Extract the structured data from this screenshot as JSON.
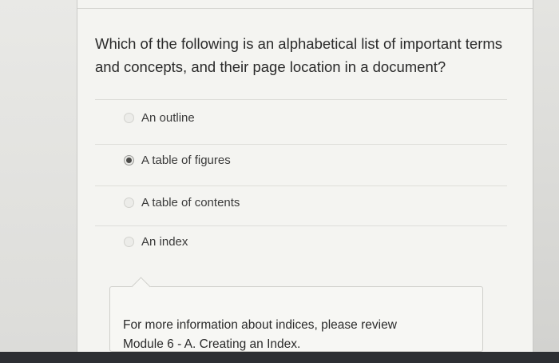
{
  "question": {
    "text_line1": "Which of the following is an alphabetical list of important terms",
    "text_line2": "and concepts, and their page location in a document?"
  },
  "options": [
    {
      "label": "An outline",
      "selected": false
    },
    {
      "label": "A table of figures",
      "selected": true
    },
    {
      "label": "A table of contents",
      "selected": false
    },
    {
      "label": "An index",
      "selected": false
    }
  ],
  "feedback": {
    "line1": "For more information about indices, please review",
    "line2": "Module 6 - A. Creating an Index."
  }
}
